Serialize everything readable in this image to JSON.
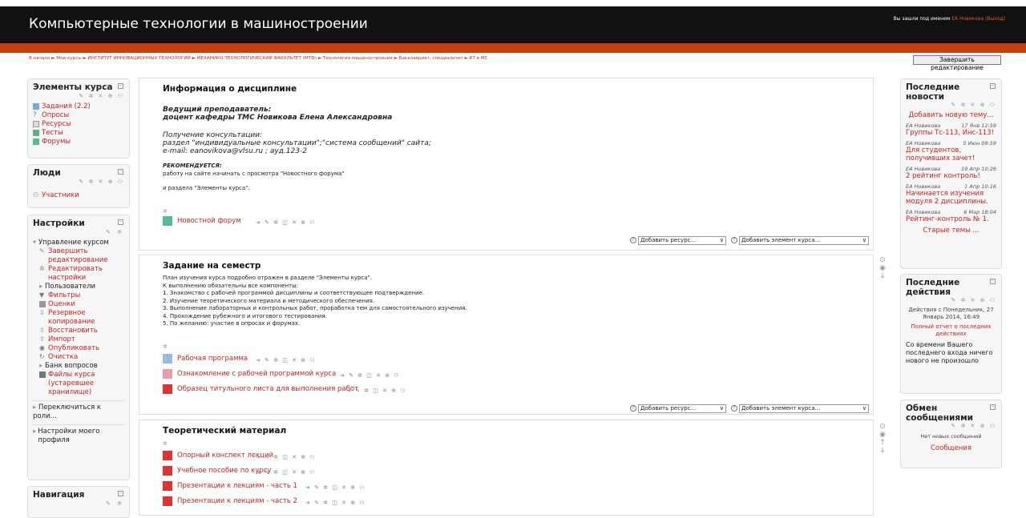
{
  "header": {
    "title": "Компьютерные технологии в машиностроении",
    "login_prefix": "Вы зашли под именем",
    "login_name": "ЕА Новикова",
    "logout": "(Выход)"
  },
  "breadcrumb": "В начало ► Мои курсы ► ИНСТИТУТ ИННОВАЦИОННЫХ ТЕХНОЛОГИЙ ► МЕХАНИКО-ТЕХНОЛОГИЧЕСКИЙ ФАКУЛЬТЕТ (МТФ) ► Технология машиностроения ► Бакалавриат, специалитет ► КТ в МС",
  "finish_edit": "Завершить редактирование",
  "left": {
    "elements": {
      "title": "Элементы курса",
      "items": [
        "Задания (2.2)",
        "Опросы",
        "Ресурсы",
        "Тесты",
        "Форумы"
      ]
    },
    "people": {
      "title": "Люди",
      "item": "Участники"
    },
    "settings": {
      "title": "Настройки",
      "manage": "Управление курсом",
      "items": [
        "Завершить редактирование",
        "Редактировать настройки",
        "Пользователи",
        "Фильтры",
        "Оценки",
        "Резервное копирование",
        "Восстановить",
        "Импорт",
        "Опубликовать",
        "Очистка",
        "Банк вопросов",
        "Файлы курса (устаревшее хранилище)"
      ],
      "switch_role": "Переключиться к роли...",
      "profile": "Настройки моего профиля"
    },
    "navigation": {
      "title": "Навигация"
    }
  },
  "controls": "✎ ✲ ✕ ⊕ ⚇",
  "res_controls": "➔ ✎ ✲ ◫ ✕ ⊕ ⚇",
  "add_resource": "Добавить ресурс...",
  "add_activity": "Добавить элемент курса...",
  "sections": [
    {
      "title": "Информация о дисциплине",
      "lines": [
        "Ведущий преподаватель:",
        "доцент кафедры ТМС Новикова Елена Александровна",
        "Получение консультации:",
        "раздел \"индивидуальные консультации\";\"система сообщений\" сайта;",
        "e-mail: eanovikova@vlsu.ru ; ауд.123-2",
        "РЕКОМЕНДУЕТСЯ:",
        "работу на сайте начинать с просмотра \"Новостного форума\"",
        "и раздела \"Элементы курса\"."
      ],
      "forum": "Новостной форум"
    },
    {
      "title": "Задание на семестр",
      "lines": [
        "План изучения курса подробно отражен в разделе \"Элементы курса\".",
        "К выполнению обязательны все компоненты:",
        "1. Знакомство с рабочей программой дисциплины и соответствующее подтверждение.",
        "2. Изучение теоретического материала и методического обеспечения.",
        "3. Выполнение лабораторных и контрольных работ, проработка тем для самостоятельного изучения.",
        "4. Прохождение рубежного и итогового тестирования.",
        "5. По желанию: участие в опросах и форумах."
      ],
      "resources": [
        "Рабочая программа",
        "Ознакомление с рабочей программой курса",
        "Образец титульного листа для выполнения работ"
      ]
    },
    {
      "title": "Теоретический материал",
      "resources": [
        "Опорный конспект лекций",
        "Учебное пособие по курсу",
        "Презентации к лекциям - часть 1",
        "Презентации к лекциям - часть 2"
      ]
    }
  ],
  "right": {
    "news": {
      "title": "Последние новости",
      "add": "Добавить новую тему...",
      "items": [
        {
          "author": "ЕА Новикова",
          "date": "17 Янв 12:59",
          "text": "Группы Тс-113, Инс-113!"
        },
        {
          "author": "ЕА Новикова",
          "date": "5 Июн 09:59",
          "text": "Для студентов, получивших зачет!"
        },
        {
          "author": "ЕА Новикова",
          "date": "19 Апр 10:26",
          "text": "2 рейтинг контроль!"
        },
        {
          "author": "ЕА Новикова",
          "date": "1 Апр 10:16",
          "text": "Начинается изучения модуля 2 дисциплины."
        },
        {
          "author": "ЕА Новикова",
          "date": "6 Мар 18:04",
          "text": "Рейтинг-контроль № 1."
        }
      ],
      "older": "Старые темы ..."
    },
    "recent": {
      "title": "Последние действия",
      "since": "Действия с Понедельник, 27 Январь 2014, 16:49",
      "report": "Полный отчет о последних действиях",
      "none": "Со времени Вашего последнего входа ничего нового не произошло"
    },
    "messages": {
      "title": "Обмен сообщениями",
      "none": "Нет новых сообщений",
      "link": "Сообщения"
    }
  },
  "colors": {
    "header": "#111111",
    "accent": "#c6400b",
    "link": "#cc2222"
  }
}
